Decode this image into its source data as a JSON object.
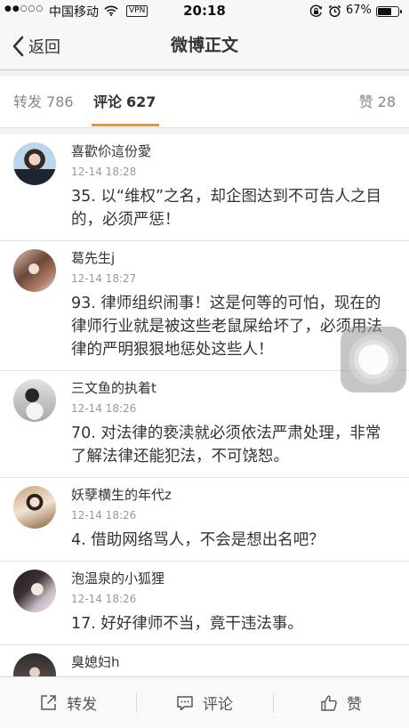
{
  "status_bar": {
    "signal": "●●○○○",
    "carrier": "中国移动",
    "vpn": "VPN",
    "time": "20:18",
    "battery": "67%"
  },
  "nav": {
    "back_label": "返回",
    "title": "微博正文"
  },
  "tabs": [
    {
      "label": "转发",
      "count": "786"
    },
    {
      "label": "评论",
      "count": "627"
    },
    {
      "label": "赞",
      "count": "28"
    }
  ],
  "active_tab": "评论",
  "comments": [
    {
      "name": "喜歡伱這份愛",
      "time": "12-14 18:28",
      "text": "35. 以“维权”之名，却企图达到不可告人之目的，必须严惩！"
    },
    {
      "name": "葛先生j",
      "time": "12-14 18:27",
      "text": "93. 律师组织闹事！这是何等的可怕，现在的律师行业就是被这些老鼠屎给坏了，必须用法律的严明狠狠地惩处这些人！"
    },
    {
      "name": "三文鱼的执着t",
      "time": "12-14 18:26",
      "text": "70. 对法律的亵渎就必须依法严肃处理，非常了解法律还能犯法，不可饶恕。"
    },
    {
      "name": "妖孽横生的年代z",
      "time": "12-14 18:26",
      "text": "4. 借助网络骂人，不会是想出名吧？"
    },
    {
      "name": "泡温泉的小狐狸",
      "time": "12-14 18:26",
      "text": "17. 好好律师不当，竟干违法事。"
    },
    {
      "name": "臭媳妇h"
    }
  ],
  "toolbar": {
    "repost": "转发",
    "comment": "评论",
    "like": "赞"
  },
  "icons": {
    "wifi": "wifi-icon",
    "rotation_lock": "rotation-lock-icon",
    "alarm": "alarm-icon",
    "battery": "battery-icon",
    "back": "chevron-left-icon",
    "repost": "share-icon",
    "comment": "comment-icon",
    "like": "thumbs-up-icon",
    "assistive_touch": "assistive-touch-icon"
  },
  "colors": {
    "accent": "#f7931e",
    "text_primary": "#333333",
    "text_secondary": "#999999",
    "background": "#f2f2f2"
  }
}
